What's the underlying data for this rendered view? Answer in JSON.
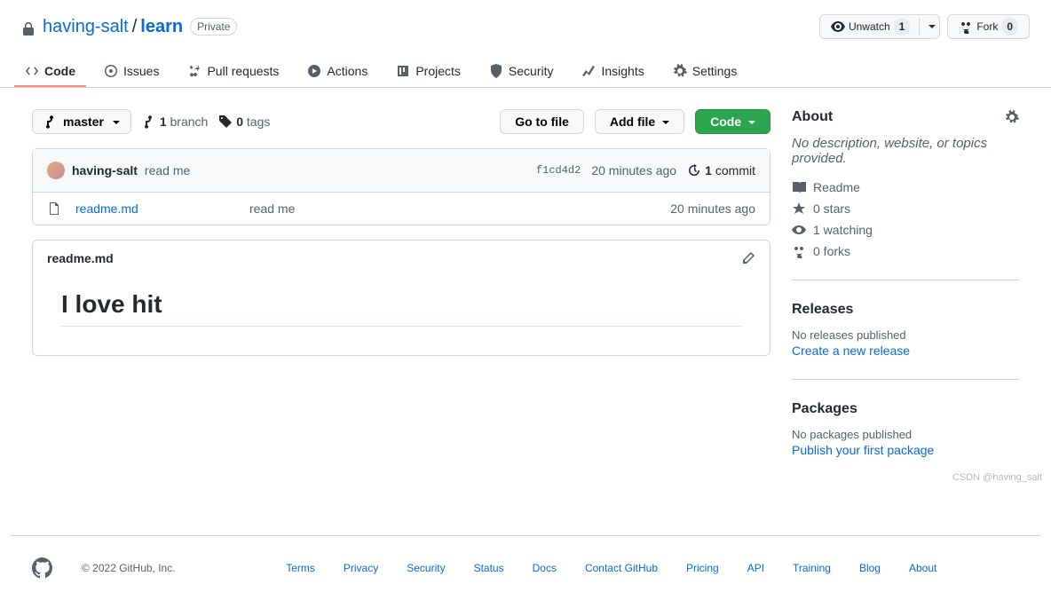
{
  "repo": {
    "owner": "having-salt",
    "name": "learn",
    "visibility": "Private"
  },
  "watch": {
    "label": "Unwatch",
    "count": "1"
  },
  "fork": {
    "label": "Fork",
    "count": "0"
  },
  "tabs": {
    "code": "Code",
    "issues": "Issues",
    "pulls": "Pull requests",
    "actions": "Actions",
    "projects": "Projects",
    "security": "Security",
    "insights": "Insights",
    "settings": "Settings"
  },
  "branch": {
    "name": "master"
  },
  "branches": {
    "count": "1",
    "label": "branch"
  },
  "tags": {
    "count": "0",
    "label": "tags"
  },
  "buttons": {
    "gotofile": "Go to file",
    "addfile": "Add file",
    "code": "Code"
  },
  "last_commit": {
    "author": "having-salt",
    "message": "read me",
    "sha": "f1cd4d2",
    "time": "20 minutes ago",
    "commits_count": "1",
    "commits_label": "commit"
  },
  "files": [
    {
      "name": "readme.md",
      "msg": "read me",
      "time": "20 minutes ago"
    }
  ],
  "readme": {
    "filename": "readme.md",
    "heading": "I love hit"
  },
  "about": {
    "title": "About",
    "empty": "No description, website, or topics provided.",
    "readme": "Readme",
    "stars": "0 stars",
    "watching": "1 watching",
    "forks": "0 forks"
  },
  "releases": {
    "title": "Releases",
    "empty": "No releases published",
    "link": "Create a new release"
  },
  "packages": {
    "title": "Packages",
    "empty": "No packages published",
    "link": "Publish your first package"
  },
  "footer": {
    "copyright": "© 2022 GitHub, Inc.",
    "links": [
      "Terms",
      "Privacy",
      "Security",
      "Status",
      "Docs",
      "Contact GitHub",
      "Pricing",
      "API",
      "Training",
      "Blog",
      "About"
    ]
  },
  "watermark": "CSDN @having_salt"
}
